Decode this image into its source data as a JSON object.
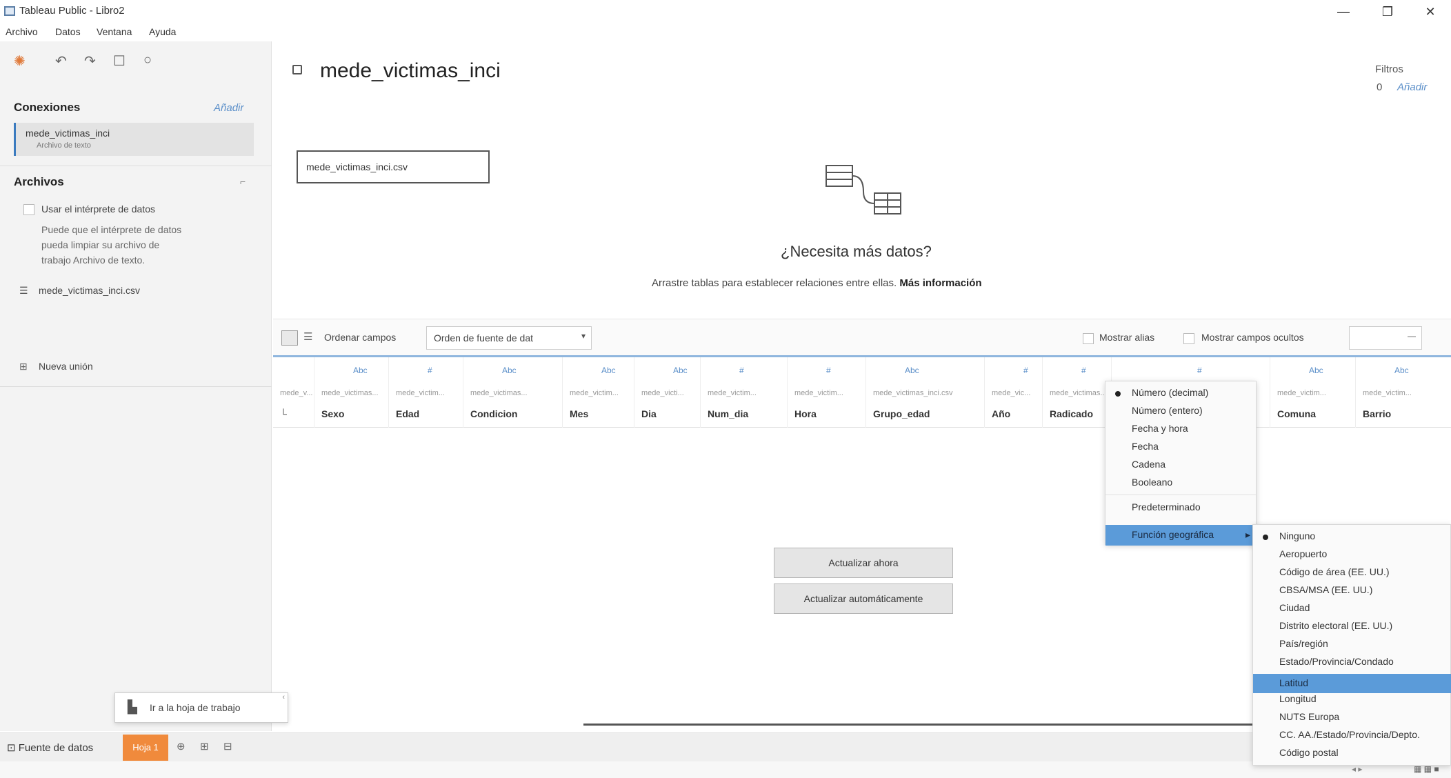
{
  "window": {
    "title": "Tableau Public - Libro2",
    "minimize": "—",
    "maximize": "❐",
    "close": "✕"
  },
  "menu": [
    "Archivo",
    "Datos",
    "Ventana",
    "Ayuda"
  ],
  "sidebar": {
    "connections_title": "Conexiones",
    "connections_add": "Añadir",
    "connection_name": "mede_victimas_inci",
    "connection_type": "Archivo de texto",
    "files_title": "Archivos",
    "use_interpreter": "Usar el intérprete de datos",
    "interpreter_help": [
      "Puede que el intérprete de datos",
      "pueda limpiar su archivo de",
      "trabajo Archivo de texto."
    ],
    "file_item": "mede_victimas_inci.csv",
    "new_union": "Nueva unión"
  },
  "main": {
    "datasource_title": "mede_victimas_inci",
    "filters_label": "Filtros",
    "filters_count": "0",
    "filters_add": "Añadir",
    "connection_table": "mede_victimas_inci.csv",
    "need_more_title": "¿Necesita más datos?",
    "need_more_sub": "Arrastre tablas para establecer relaciones entre ellas.",
    "need_more_link": "Más información"
  },
  "grid_toolbar": {
    "sort_label": "Ordenar campos",
    "sort_value": "Orden de fuente de dat",
    "show_aliases": "Mostrar alias",
    "show_hidden": "Mostrar campos ocultos",
    "rows_value": ""
  },
  "columns": [
    {
      "icon": "#",
      "source": "mede_v...",
      "name": "..."
    },
    {
      "icon": "Abc",
      "source": "mede_victimas...",
      "name": "Sexo"
    },
    {
      "icon": "#",
      "source": "mede_victim...",
      "name": "Edad"
    },
    {
      "icon": "Abc",
      "source": "mede_victimas...",
      "name": "Condicion"
    },
    {
      "icon": "Abc",
      "source": "mede_victim...",
      "name": "Mes"
    },
    {
      "icon": "Abc",
      "source": "mede_victi...",
      "name": "Dia"
    },
    {
      "icon": "#",
      "source": "mede_victim...",
      "name": "Num_dia"
    },
    {
      "icon": "#",
      "source": "mede_victim...",
      "name": "Hora"
    },
    {
      "icon": "Abc",
      "source": "mede_victimas_inci.csv",
      "name": "Grupo_edad"
    },
    {
      "icon": "#",
      "source": "mede_vic...",
      "name": "Año"
    },
    {
      "icon": "#",
      "source": "mede_victimas...",
      "name": "Radicado"
    },
    {
      "icon": "#",
      "source": "",
      "name": ""
    },
    {
      "icon": "Abc",
      "source": "mede_victim...",
      "name": "Comuna"
    },
    {
      "icon": "Abc",
      "source": "mede_victim...",
      "name": "Barrio"
    }
  ],
  "context_menu": {
    "items": [
      "Número (decimal)",
      "Número (entero)",
      "Fecha y hora",
      "Fecha",
      "Cadena",
      "Booleano"
    ],
    "default_item": "Predeterminado",
    "geo_item": "Función geográfica",
    "arrow": "▸"
  },
  "geo_menu": {
    "items": [
      "Ninguno",
      "Aeropuerto",
      "Código de área (EE. UU.)",
      "CBSA/MSA (EE. UU.)",
      "Ciudad",
      "Distrito electoral (EE. UU.)",
      "País/región",
      "Estado/Provincia/Condado",
      "Latitud",
      "Longitud",
      "NUTS Europa",
      "CC. AA./Estado/Provincia/Depto.",
      "Código postal"
    ],
    "highlighted": "Latitud"
  },
  "buttons": {
    "update_now": "Actualizar ahora",
    "auto_update": "Actualizar automáticamente"
  },
  "sheet_tip": "Ir a la hoja de trabajo",
  "tabbar": {
    "datasource_tab": "Fuente de datos",
    "sheet_tab": "Hoja 1"
  }
}
